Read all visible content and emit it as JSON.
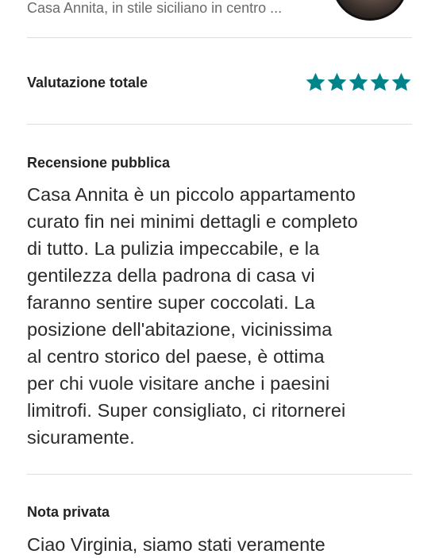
{
  "listing": {
    "subtitle": "Casa Annita, in stile siciliano in centro  ..."
  },
  "overall": {
    "label": "Valutazione totale",
    "rating": 5,
    "max_rating": 5,
    "star_color": "#008489"
  },
  "public_review": {
    "heading": "Recensione pubblica",
    "lines": [
      "Casa Annita è un piccolo appartamento",
      "curato fin nei minimi dettagli e completo",
      "di tutto. La pulizia impeccabile, e la",
      "gentilezza della padrona di casa vi",
      "faranno sentire super coccolati. La",
      "posizione dell'abitazione, vicinissima",
      "al centro storico del paese, è ottima",
      "per chi vuole visitare anche i paesini",
      "limitrofi. Super consigliato, ci ritornerei",
      "sicuramente."
    ]
  },
  "private_note": {
    "heading": "Nota privata",
    "text": "Ciao Virginia, siamo stati veramente"
  }
}
